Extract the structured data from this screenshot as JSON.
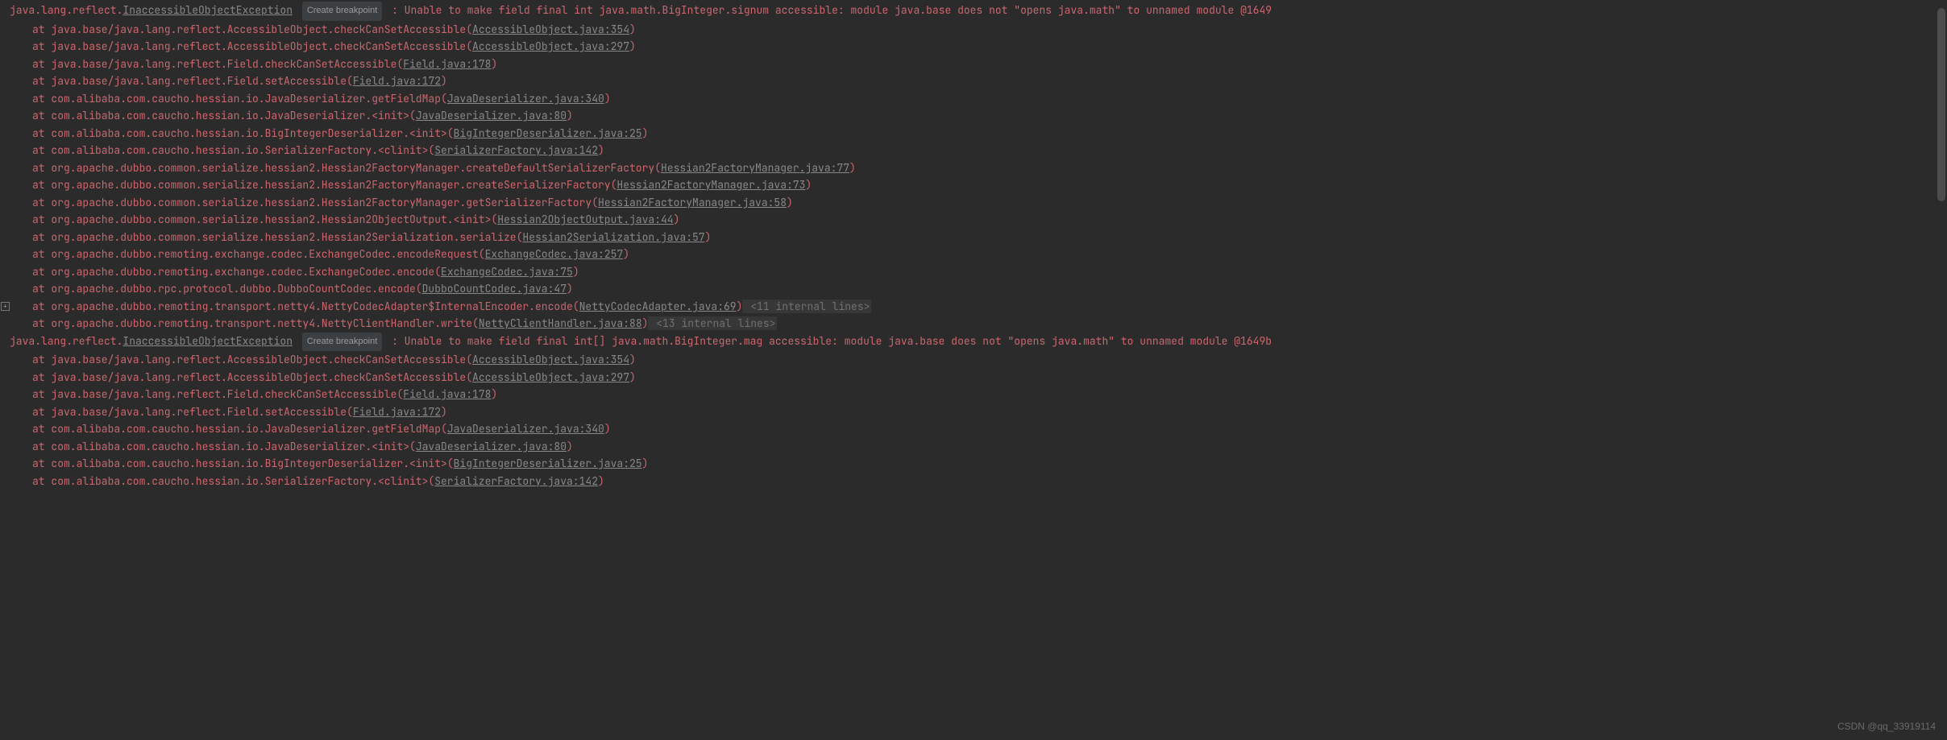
{
  "breakpoint_label": "Create breakpoint",
  "watermark": "CSDN @qq_33919114",
  "exceptions": [
    {
      "class_prefix": "java.lang.reflect.",
      "class_link": "InaccessibleObjectException",
      "message": ": Unable to make field final int java.math.BigInteger.signum accessible: module java.base does not \"opens java.math\" to unnamed module @1649",
      "frames": [
        {
          "text": "at java.base/java.lang.reflect.AccessibleObject.checkCanSetAccessible(",
          "link": "AccessibleObject.java:354",
          "after": ")"
        },
        {
          "text": "at java.base/java.lang.reflect.AccessibleObject.checkCanSetAccessible(",
          "link": "AccessibleObject.java:297",
          "after": ")"
        },
        {
          "text": "at java.base/java.lang.reflect.Field.checkCanSetAccessible(",
          "link": "Field.java:178",
          "after": ")"
        },
        {
          "text": "at java.base/java.lang.reflect.Field.setAccessible(",
          "link": "Field.java:172",
          "after": ")"
        },
        {
          "text": "at com.alibaba.com.caucho.hessian.io.JavaDeserializer.getFieldMap(",
          "link": "JavaDeserializer.java:340",
          "after": ")"
        },
        {
          "text": "at com.alibaba.com.caucho.hessian.io.JavaDeserializer.<init>(",
          "link": "JavaDeserializer.java:80",
          "after": ")"
        },
        {
          "text": "at com.alibaba.com.caucho.hessian.io.BigIntegerDeserializer.<init>(",
          "link": "BigIntegerDeserializer.java:25",
          "after": ")"
        },
        {
          "text": "at com.alibaba.com.caucho.hessian.io.SerializerFactory.<clinit>(",
          "link": "SerializerFactory.java:142",
          "after": ")"
        },
        {
          "text": "at org.apache.dubbo.common.serialize.hessian2.Hessian2FactoryManager.createDefaultSerializerFactory(",
          "link": "Hessian2FactoryManager.java:77",
          "after": ")"
        },
        {
          "text": "at org.apache.dubbo.common.serialize.hessian2.Hessian2FactoryManager.createSerializerFactory(",
          "link": "Hessian2FactoryManager.java:73",
          "after": ")"
        },
        {
          "text": "at org.apache.dubbo.common.serialize.hessian2.Hessian2FactoryManager.getSerializerFactory(",
          "link": "Hessian2FactoryManager.java:58",
          "after": ")"
        },
        {
          "text": "at org.apache.dubbo.common.serialize.hessian2.Hessian2ObjectOutput.<init>(",
          "link": "Hessian2ObjectOutput.java:44",
          "after": ")"
        },
        {
          "text": "at org.apache.dubbo.common.serialize.hessian2.Hessian2Serialization.serialize(",
          "link": "Hessian2Serialization.java:57",
          "after": ")"
        },
        {
          "text": "at org.apache.dubbo.remoting.exchange.codec.ExchangeCodec.encodeRequest(",
          "link": "ExchangeCodec.java:257",
          "after": ")"
        },
        {
          "text": "at org.apache.dubbo.remoting.exchange.codec.ExchangeCodec.encode(",
          "link": "ExchangeCodec.java:75",
          "after": ")"
        },
        {
          "text": "at org.apache.dubbo.rpc.protocol.dubbo.DubboCountCodec.encode(",
          "link": "DubboCountCodec.java:47",
          "after": ")"
        },
        {
          "text": "at org.apache.dubbo.remoting.transport.netty4.NettyCodecAdapter$InternalEncoder.encode(",
          "link": "NettyCodecAdapter.java:69",
          "after": ")",
          "internal": " <11 internal lines>",
          "fold": true
        },
        {
          "text": "at org.apache.dubbo.remoting.transport.netty4.NettyClientHandler.write(",
          "link": "NettyClientHandler.java:88",
          "after": ")",
          "internal": " <13 internal lines>"
        }
      ]
    },
    {
      "class_prefix": "java.lang.reflect.",
      "class_link": "InaccessibleObjectException",
      "message": ": Unable to make field final int[] java.math.BigInteger.mag accessible: module java.base does not \"opens java.math\" to unnamed module @1649b",
      "frames": [
        {
          "text": "at java.base/java.lang.reflect.AccessibleObject.checkCanSetAccessible(",
          "link": "AccessibleObject.java:354",
          "after": ")"
        },
        {
          "text": "at java.base/java.lang.reflect.AccessibleObject.checkCanSetAccessible(",
          "link": "AccessibleObject.java:297",
          "after": ")"
        },
        {
          "text": "at java.base/java.lang.reflect.Field.checkCanSetAccessible(",
          "link": "Field.java:178",
          "after": ")"
        },
        {
          "text": "at java.base/java.lang.reflect.Field.setAccessible(",
          "link": "Field.java:172",
          "after": ")"
        },
        {
          "text": "at com.alibaba.com.caucho.hessian.io.JavaDeserializer.getFieldMap(",
          "link": "JavaDeserializer.java:340",
          "after": ")"
        },
        {
          "text": "at com.alibaba.com.caucho.hessian.io.JavaDeserializer.<init>(",
          "link": "JavaDeserializer.java:80",
          "after": ")"
        },
        {
          "text": "at com.alibaba.com.caucho.hessian.io.BigIntegerDeserializer.<init>(",
          "link": "BigIntegerDeserializer.java:25",
          "after": ")"
        },
        {
          "text": "at com.alibaba.com.caucho.hessian.io.SerializerFactory.<clinit>(",
          "link": "SerializerFactory.java:142",
          "after": ")"
        }
      ]
    }
  ]
}
